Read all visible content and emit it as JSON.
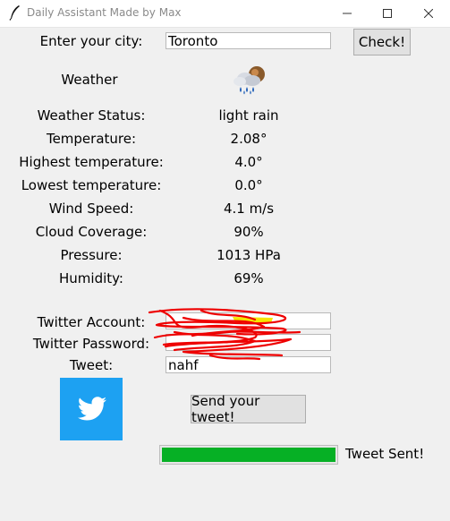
{
  "window": {
    "title": "Daily Assistant Made by Max",
    "minimize_icon": "minimize-icon",
    "maximize_icon": "maximize-icon",
    "close_icon": "close-icon"
  },
  "city": {
    "label": "Enter your city:",
    "value": "Toronto",
    "check_label": "Check!"
  },
  "weather": {
    "heading": "Weather",
    "icon": "light-rain-weather-icon",
    "rows": [
      {
        "label": "Weather Status:",
        "value": "light rain"
      },
      {
        "label": "Temperature:",
        "value": "2.08°"
      },
      {
        "label": "Highest temperature:",
        "value": "4.0°"
      },
      {
        "label": "Lowest temperature:",
        "value": "0.0°"
      },
      {
        "label": "Wind Speed:",
        "value": "4.1 m/s"
      },
      {
        "label": "Cloud Coverage:",
        "value": "90%"
      },
      {
        "label": "Pressure:",
        "value": "1013 HPa"
      },
      {
        "label": "Humidity:",
        "value": "69%"
      }
    ]
  },
  "twitter": {
    "account_label": "Twitter Account:",
    "account_value": "",
    "password_label": "Twitter Password:",
    "password_value": "",
    "tweet_label": "Tweet:",
    "tweet_value": "nahf",
    "logo": "twitter-bird-icon",
    "send_label": "Send your tweet!",
    "progress": 1.0,
    "status": "Tweet Sent!"
  },
  "colors": {
    "twitter_blue": "#1da1f2",
    "progress_green": "#06b025",
    "redaction_red": "#ee0000"
  }
}
